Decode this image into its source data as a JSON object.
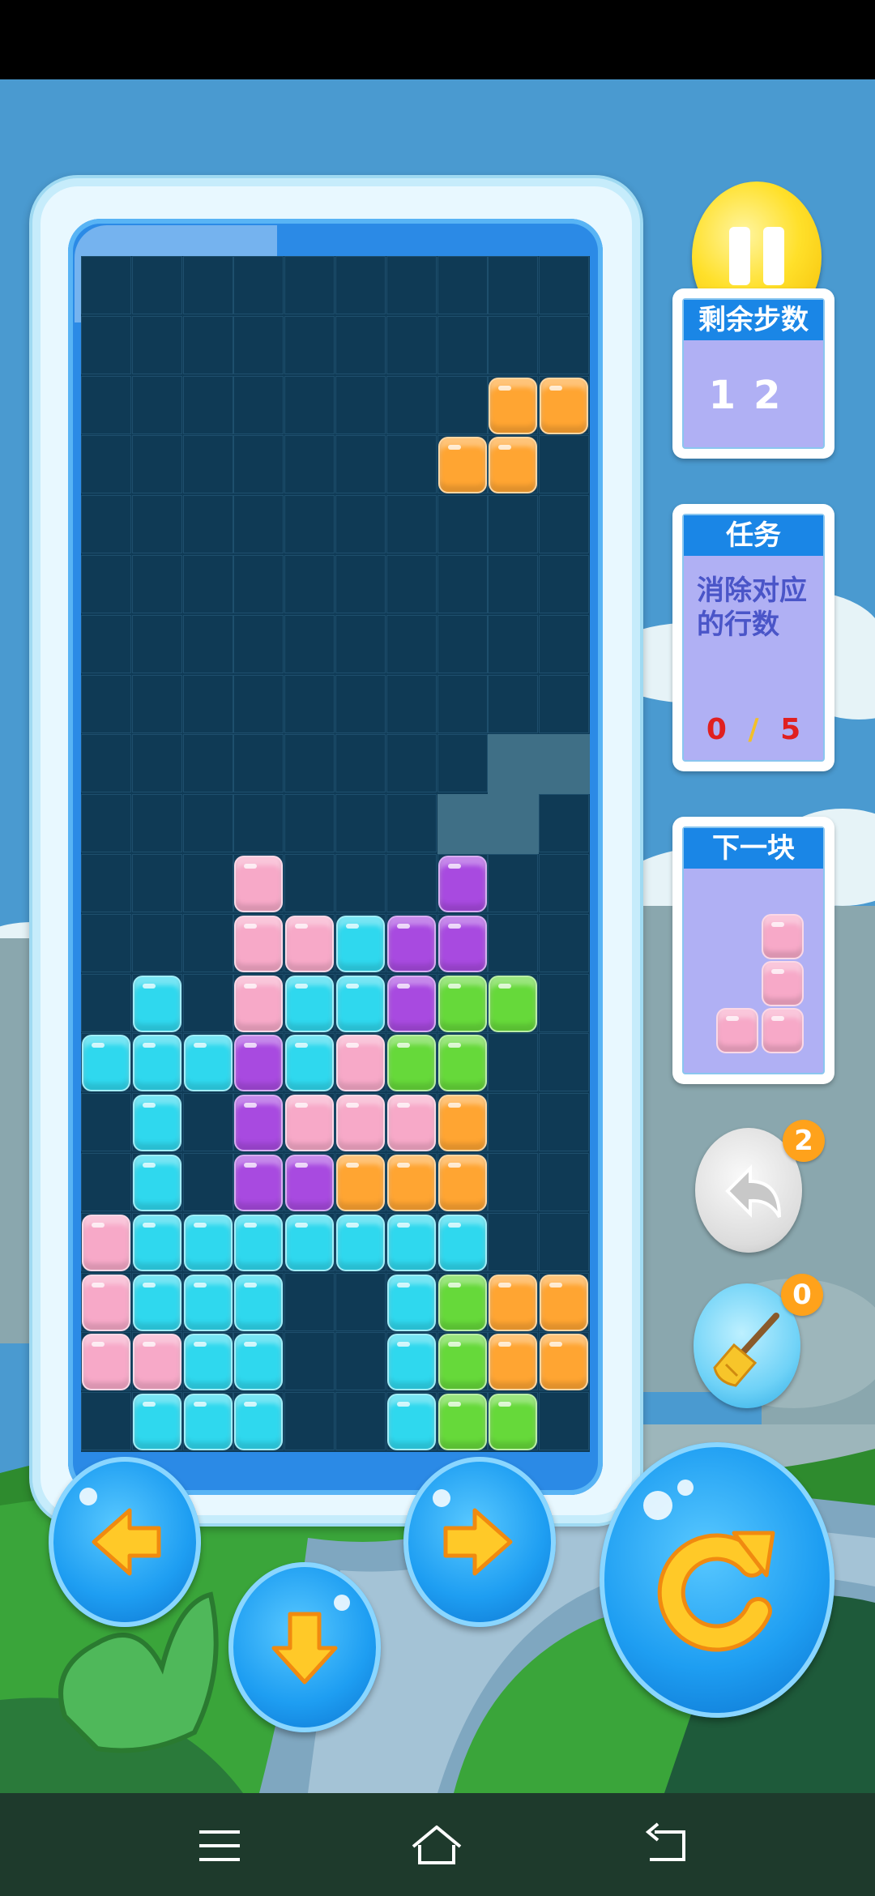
{
  "game": {
    "moves_label": "剩余步数",
    "moves_value": "12",
    "task_label": "任务",
    "task_description": "消除对应的行数",
    "task_progress_current": "0",
    "task_progress_sep": "/",
    "task_progress_target": "5",
    "next_label": "下一块",
    "undo_count": "2",
    "clear_count": "0"
  },
  "board": {
    "cols": 10,
    "rows": 20,
    "colors": {
      "O": "#ffa532",
      "C": "#2fd8ee",
      "P": "#f7a9c8",
      "V": "#a84ae0",
      "G": "#66d93a"
    },
    "cells": [
      "..........",
      "..........",
      "........OO",
      ".......OO.",
      "..........",
      "..........",
      "..........",
      "..........",
      "..........",
      "..........",
      "...P...V..",
      "...PPCVV..",
      ".C.PCCVGG.",
      "CCCVCPGG..",
      ".C.VPPPO..",
      ".C.VVOOO..",
      "PCCCCCCC..",
      "PCCC..CGOO",
      "PPCC..CGOO",
      ".CCC..CGG."
    ],
    "ghost": [
      "..........",
      "..........",
      "..........",
      "..........",
      "..........",
      "..........",
      "..........",
      "..........",
      "........SS",
      ".......SS.",
      "..........",
      "..........",
      "..........",
      "..........",
      "..........",
      "..........",
      "..........",
      "..........",
      "..........",
      ".........."
    ]
  },
  "next_piece": {
    "color": "#f7a9c8",
    "cells": [
      ".P",
      ".P",
      "PP"
    ]
  },
  "icons": {
    "pause": "pause-icon",
    "undo": "undo-icon",
    "broom": "broom-icon",
    "left": "arrow-left-icon",
    "down": "arrow-down-icon",
    "right": "arrow-right-icon",
    "rotate": "rotate-icon",
    "menu": "menu-icon",
    "home": "home-icon",
    "back": "back-icon"
  }
}
